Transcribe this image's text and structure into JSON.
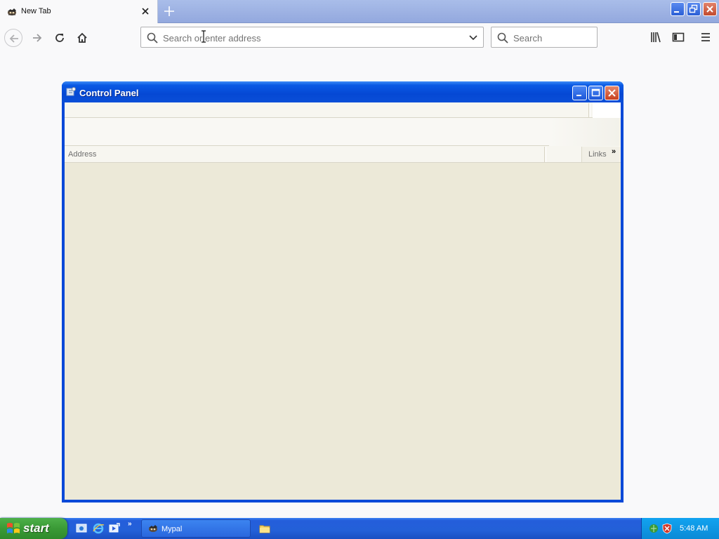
{
  "browser": {
    "tab": {
      "title": "New Tab",
      "favicon": "mypal-icon"
    },
    "urlbar": {
      "placeholder": "Search or enter address"
    },
    "searchbar": {
      "placeholder": "Search"
    }
  },
  "control_panel": {
    "title": "Control Panel",
    "address_label": "Address",
    "links_label": "Links",
    "links_overflow": "»"
  },
  "taskbar": {
    "start_label": "start",
    "quicklaunch_overflow": "»",
    "tasks": [
      {
        "label": "Mypal"
      }
    ],
    "clock": "5:48 AM"
  },
  "colors": {
    "xp_blue": "#0a49d8",
    "xp_window_face": "#ece9d8",
    "start_green": "#3a9a36",
    "tray_blue": "#0b8ad6",
    "tabstrip": "#a9bde9"
  }
}
